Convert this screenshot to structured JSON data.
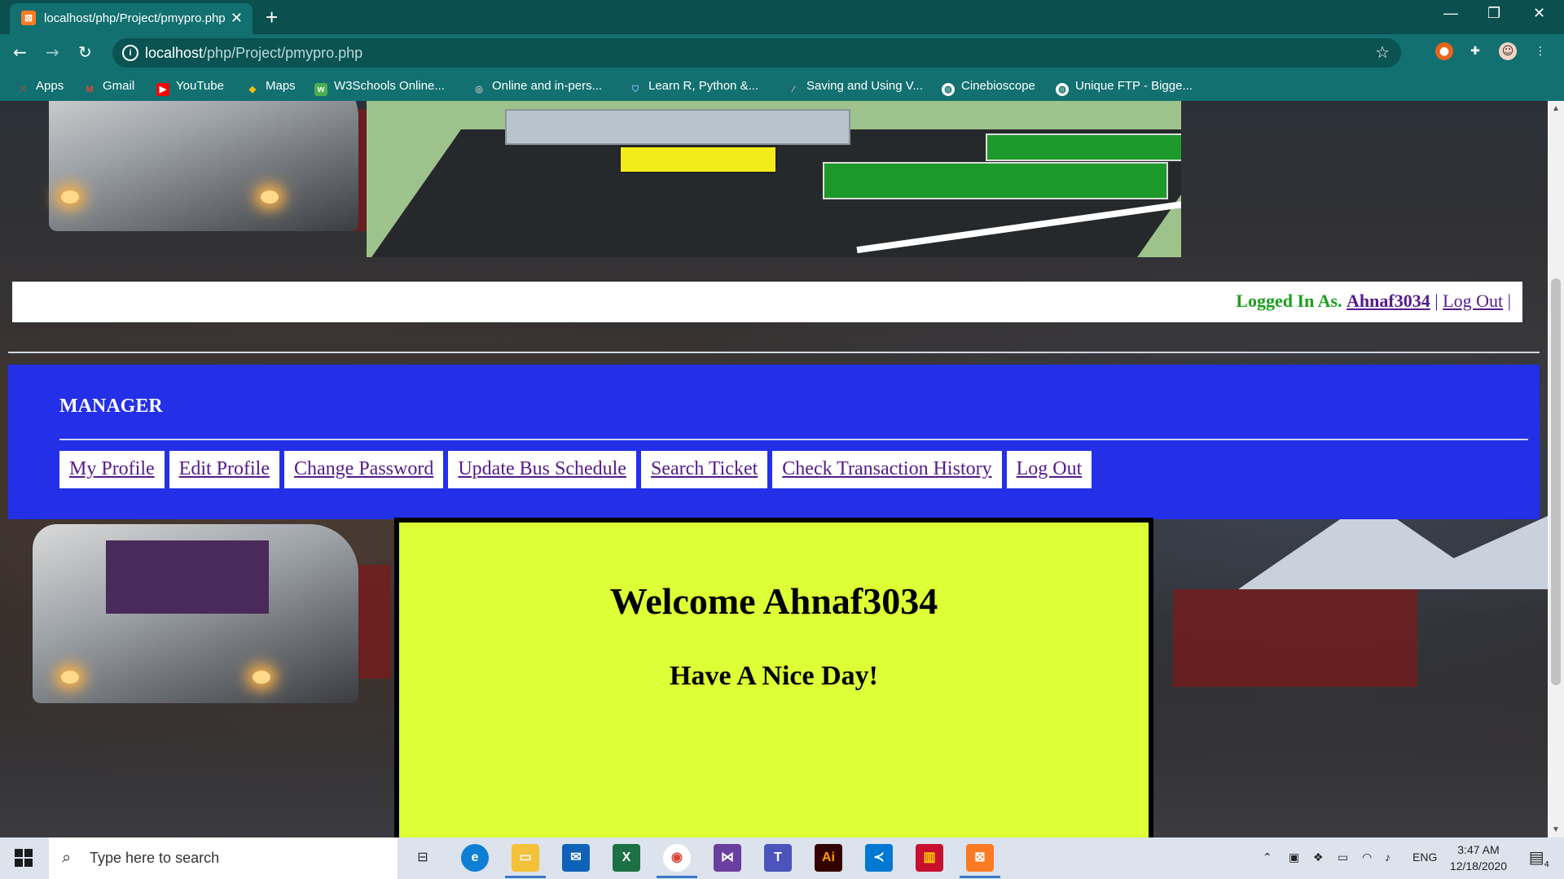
{
  "browser": {
    "tab_title": "localhost/php/Project/pmypro.php",
    "tab_favicon": "xampp-icon",
    "url_host": "localhost",
    "url_path": "/php/Project/pmypro.php"
  },
  "bookmarks": [
    {
      "label": "Apps",
      "icon": "apps-grid-icon",
      "color": "#e94235"
    },
    {
      "label": "Gmail",
      "icon": "gmail-icon",
      "color": "#ea4335"
    },
    {
      "label": "YouTube",
      "icon": "youtube-icon",
      "color": "#ff0000"
    },
    {
      "label": "Maps",
      "icon": "maps-pin-icon",
      "color": "#34a853"
    },
    {
      "label": "W3Schools Online...",
      "icon": "w3schools-icon",
      "color": "#4caf50"
    },
    {
      "label": "Online and in-pers...",
      "icon": "globe-icon",
      "color": "#999999"
    },
    {
      "label": "Learn R, Python &...",
      "icon": "shield-icon",
      "color": "#3b82f6"
    },
    {
      "label": "Saving and Using V...",
      "icon": "bookmark-icon",
      "color": "#999999"
    },
    {
      "label": "Cinebioscope",
      "icon": "globe-icon",
      "color": "#ffffff"
    },
    {
      "label": "Unique FTP - Bigge...",
      "icon": "globe-icon",
      "color": "#ffffff"
    }
  ],
  "login_bar": {
    "label": "Logged In As.",
    "username": "Ahnaf3034",
    "logout": "Log Out",
    "sep": "|"
  },
  "manager": {
    "heading": "MANAGER",
    "menu": [
      "My Profile",
      "Edit Profile",
      "Change Password",
      "Update Bus Schedule",
      "Search Ticket",
      "Check Transaction History",
      "Log Out"
    ]
  },
  "welcome": {
    "title": "Welcome Ahnaf3034",
    "subtitle": "Have A Nice Day!"
  },
  "taskbar": {
    "search_placeholder": "Type here to search",
    "language": "ENG",
    "time": "3:47 AM",
    "date": "12/18/2020",
    "notification_count": "4"
  },
  "colors": {
    "chrome_dark": "#0b4f4f",
    "chrome": "#127070",
    "manager_bg": "#2330e8",
    "welcome_bg": "#dcff36",
    "logged_label": "#1aa01a",
    "link": "#551a8b"
  }
}
